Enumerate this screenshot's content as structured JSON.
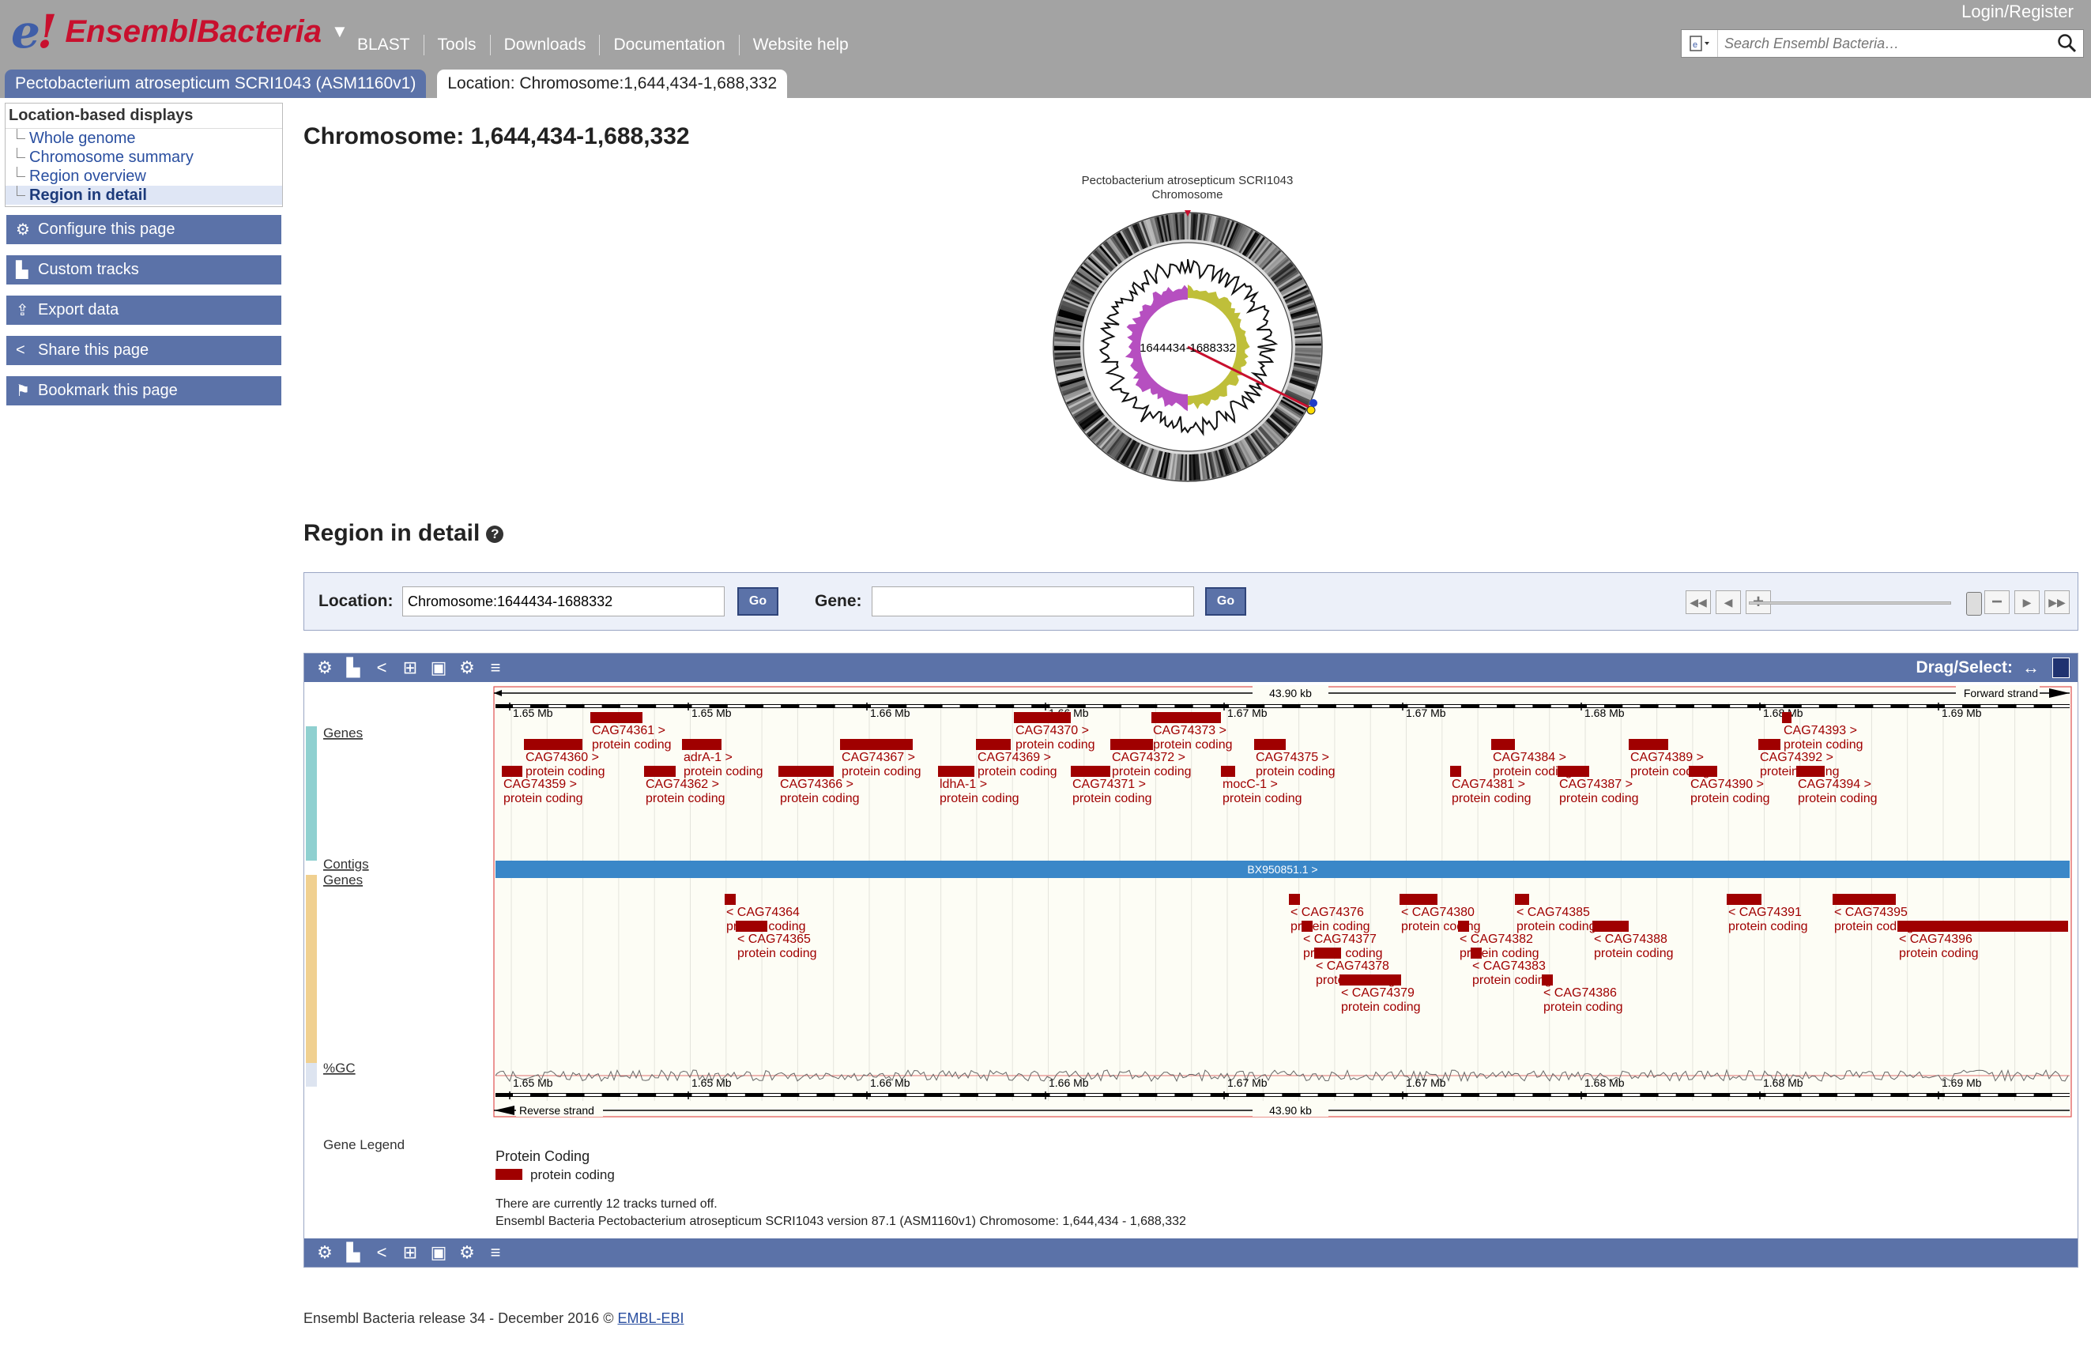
{
  "header": {
    "logo_e": "e",
    "logo_bang": "!",
    "logo_text": "EnsemblBacteria",
    "nav": [
      "BLAST",
      "Tools",
      "Downloads",
      "Documentation",
      "Website help"
    ],
    "login": "Login/Register",
    "search_placeholder": "Search Ensembl Bacteria…"
  },
  "tabs": [
    {
      "label": "Pectobacterium atrosepticum SCRI1043 (ASM1160v1)",
      "active": false
    },
    {
      "label": "Location: Chromosome:1,644,434-1,688,332",
      "active": true
    }
  ],
  "sidebar": {
    "heading": "Location-based displays",
    "items": [
      {
        "label": "Whole genome",
        "selected": false
      },
      {
        "label": "Chromosome summary",
        "selected": false
      },
      {
        "label": "Region overview",
        "selected": false
      },
      {
        "label": "Region in detail",
        "selected": true
      }
    ],
    "tools": [
      {
        "label": "Configure this page",
        "icon": "gear-icon"
      },
      {
        "label": "Custom tracks",
        "icon": "custom-tracks-icon"
      },
      {
        "label": "Export data",
        "icon": "export-icon"
      },
      {
        "label": "Share this page",
        "icon": "share-icon"
      },
      {
        "label": "Bookmark this page",
        "icon": "bookmark-icon"
      }
    ]
  },
  "main": {
    "title": "Chromosome: 1,644,434-1,688,332",
    "ideogram": {
      "caption_line1": "Pectobacterium atrosepticum SCRI1043",
      "caption_line2": "Chromosome",
      "center_label": "1644434-1688332"
    },
    "region_title": "Region in detail",
    "location_label": "Location:",
    "location_value": "Chromosome:1644434-1688332",
    "gene_label": "Gene:",
    "gene_value": "",
    "go_label": "Go"
  },
  "browser": {
    "drag_select_label": "Drag/Select:",
    "scale_label": "43.90 kb",
    "forward_strand": "Forward strand",
    "reverse_strand": "Reverse strand",
    "ticks": [
      "1.65 Mb",
      "1.65 Mb",
      "1.66 Mb",
      "1.66 Mb",
      "1.67 Mb",
      "1.67 Mb",
      "1.68 Mb",
      "1.68 Mb",
      "1.69 Mb"
    ],
    "track_labels": {
      "genes_fwd": "Genes",
      "contigs": "Contigs",
      "genes_rev": "Genes",
      "gc": "%GC"
    },
    "contig_label": "BX950851.1 >",
    "gene_type": "protein coding",
    "forward_genes": [
      {
        "name": "CAG74361 >",
        "row": 0
      },
      {
        "name": "CAG74370 >",
        "row": 0
      },
      {
        "name": "CAG74373 >",
        "row": 0
      },
      {
        "name": "CAG74393 >",
        "row": 0
      },
      {
        "name": "CAG74360 >",
        "row": 1
      },
      {
        "name": "adrA-1 >",
        "row": 1
      },
      {
        "name": "CAG74367 >",
        "row": 1
      },
      {
        "name": "CAG74369 >",
        "row": 1
      },
      {
        "name": "CAG74372 >",
        "row": 1
      },
      {
        "name": "CAG74375 >",
        "row": 1
      },
      {
        "name": "CAG74384 >",
        "row": 1
      },
      {
        "name": "CAG74389 >",
        "row": 1
      },
      {
        "name": "CAG74392 >",
        "row": 1
      },
      {
        "name": "CAG74359 >",
        "row": 2
      },
      {
        "name": "CAG74362 >",
        "row": 2
      },
      {
        "name": "CAG74366 >",
        "row": 2
      },
      {
        "name": "ldhA-1 >",
        "row": 2
      },
      {
        "name": "CAG74371 >",
        "row": 2
      },
      {
        "name": "mocC-1 >",
        "row": 2
      },
      {
        "name": "CAG74381 >",
        "row": 2
      },
      {
        "name": "CAG74387 >",
        "row": 2
      },
      {
        "name": "CAG74390 >",
        "row": 2
      },
      {
        "name": "CAG74394 >",
        "row": 2
      }
    ],
    "reverse_genes": [
      {
        "name": "< CAG74364",
        "row": 0
      },
      {
        "name": "< CAG74376",
        "row": 0
      },
      {
        "name": "< CAG74380",
        "row": 0
      },
      {
        "name": "< CAG74385",
        "row": 0
      },
      {
        "name": "< CAG74391",
        "row": 0
      },
      {
        "name": "< CAG74395",
        "row": 0
      },
      {
        "name": "< CAG74365",
        "row": 1
      },
      {
        "name": "< CAG74377",
        "row": 1
      },
      {
        "name": "< CAG74382",
        "row": 1
      },
      {
        "name": "< CAG74388",
        "row": 1
      },
      {
        "name": "< CAG74396",
        "row": 1
      },
      {
        "name": "< CAG74378",
        "row": 2
      },
      {
        "name": "< CAG74383",
        "row": 2
      },
      {
        "name": "< CAG74379",
        "row": 3
      },
      {
        "name": "< CAG74386",
        "row": 3
      }
    ],
    "legend_label": "Gene Legend",
    "legend_title": "Protein Coding",
    "legend_item": "protein coding",
    "tracks_off": "There are currently 12 tracks turned off.",
    "version_line": "Ensembl Bacteria Pectobacterium atrosepticum SCRI1043 version 87.1 (ASM1160v1) Chromosome: 1,644,434 - 1,688,332"
  },
  "footer": {
    "text": "Ensembl Bacteria release 34 - December 2016 © ",
    "link": "EMBL-EBI"
  },
  "colors": {
    "gene": "#a00000",
    "contig": "#3a87c8",
    "toolbar": "#5b72a8",
    "header": "#a3a3a3"
  }
}
